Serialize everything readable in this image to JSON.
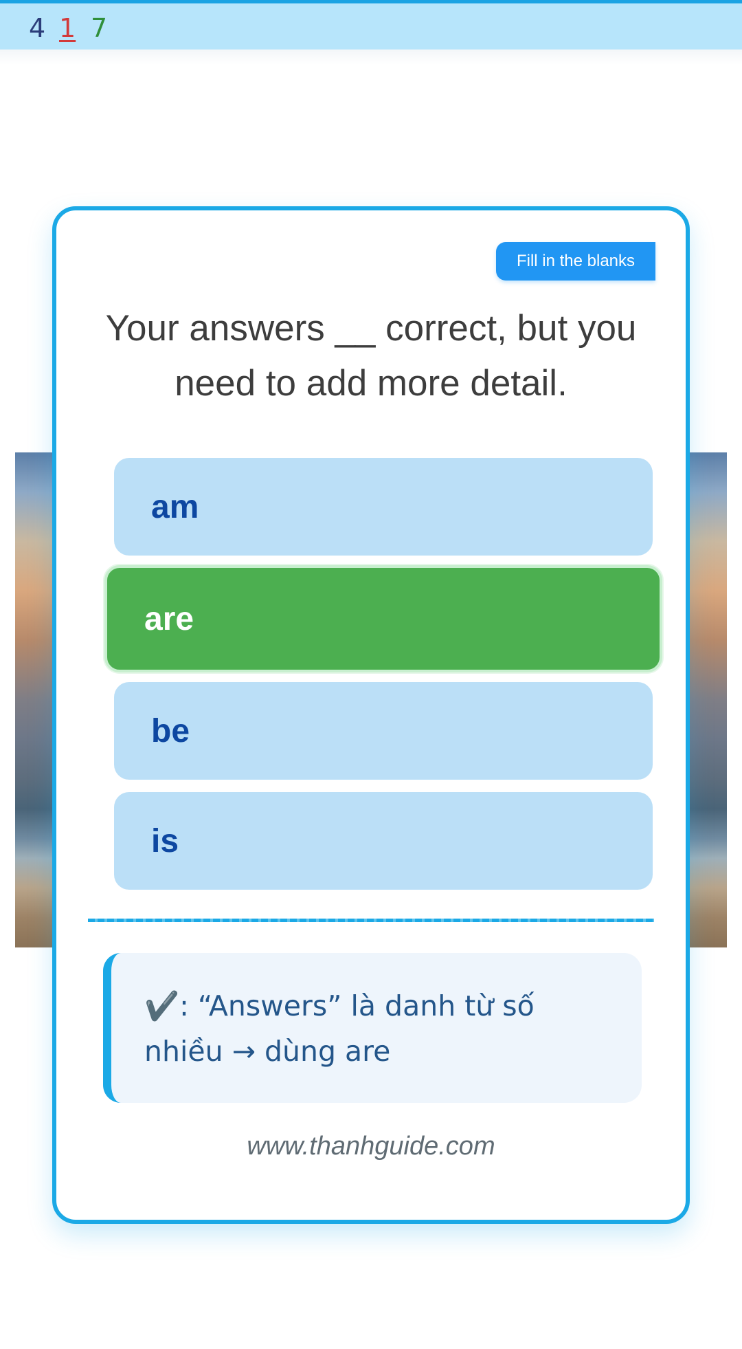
{
  "top_bar": {
    "numbers": [
      "4",
      "1",
      "7"
    ]
  },
  "card": {
    "badge": "Fill in the blanks",
    "question": "Your answers __ correct, but you need to add more detail.",
    "options": [
      {
        "label": "am",
        "selected": false
      },
      {
        "label": "are",
        "selected": true
      },
      {
        "label": "be",
        "selected": false
      },
      {
        "label": "is",
        "selected": false
      }
    ],
    "explanation": {
      "icon": "✔️",
      "text": ": “Answers” là danh từ số nhiều → dùng are"
    },
    "footer": "www.thanhguide.com"
  },
  "colors": {
    "accent": "#1ba9e6",
    "badge": "#2196f3",
    "option_bg": "#bbdff7",
    "option_text": "#0d47a1",
    "correct": "#4caf50"
  }
}
